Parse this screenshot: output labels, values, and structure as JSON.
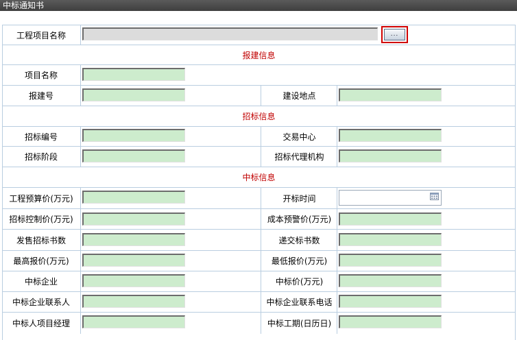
{
  "window": {
    "title": "中标通知书"
  },
  "project": {
    "label": "工程项目名称",
    "value": "",
    "browse_label": "..."
  },
  "sections": {
    "baojian": "报建信息",
    "zhaobiao": "招标信息",
    "zhongbiao": "中标信息"
  },
  "fields": {
    "xmmc": {
      "label": "项目名称",
      "value": ""
    },
    "bjh": {
      "label": "报建号",
      "value": ""
    },
    "jsdd": {
      "label": "建设地点",
      "value": ""
    },
    "zbbh": {
      "label": "招标编号",
      "value": ""
    },
    "jyzx": {
      "label": "交易中心",
      "value": ""
    },
    "zbjd": {
      "label": "招标阶段",
      "value": ""
    },
    "zbdljg": {
      "label": "招标代理机构",
      "value": ""
    },
    "gcysj": {
      "label": "工程预算价(万元)",
      "value": ""
    },
    "kbsj": {
      "label": "开标时间",
      "value": ""
    },
    "zbkzj": {
      "label": "招标控制价(万元)",
      "value": ""
    },
    "cbyjj": {
      "label": "成本预警价(万元)",
      "value": ""
    },
    "fszbss": {
      "label": "发售招标书数",
      "value": ""
    },
    "djbss": {
      "label": "递交标书数",
      "value": ""
    },
    "zgbj": {
      "label": "最高报价(万元)",
      "value": ""
    },
    "zdbj": {
      "label": "最低报价(万元)",
      "value": ""
    },
    "zbqy": {
      "label": "中标企业",
      "value": ""
    },
    "zbj": {
      "label": "中标价(万元)",
      "value": ""
    },
    "zbqylxr": {
      "label": "中标企业联系人",
      "value": ""
    },
    "zbqylxdh": {
      "label": "中标企业联系电话",
      "value": ""
    },
    "zbrxmjl": {
      "label": "中标人项目经理",
      "value": ""
    },
    "zbgq": {
      "label": "中标工期(日历日)",
      "value": ""
    }
  }
}
